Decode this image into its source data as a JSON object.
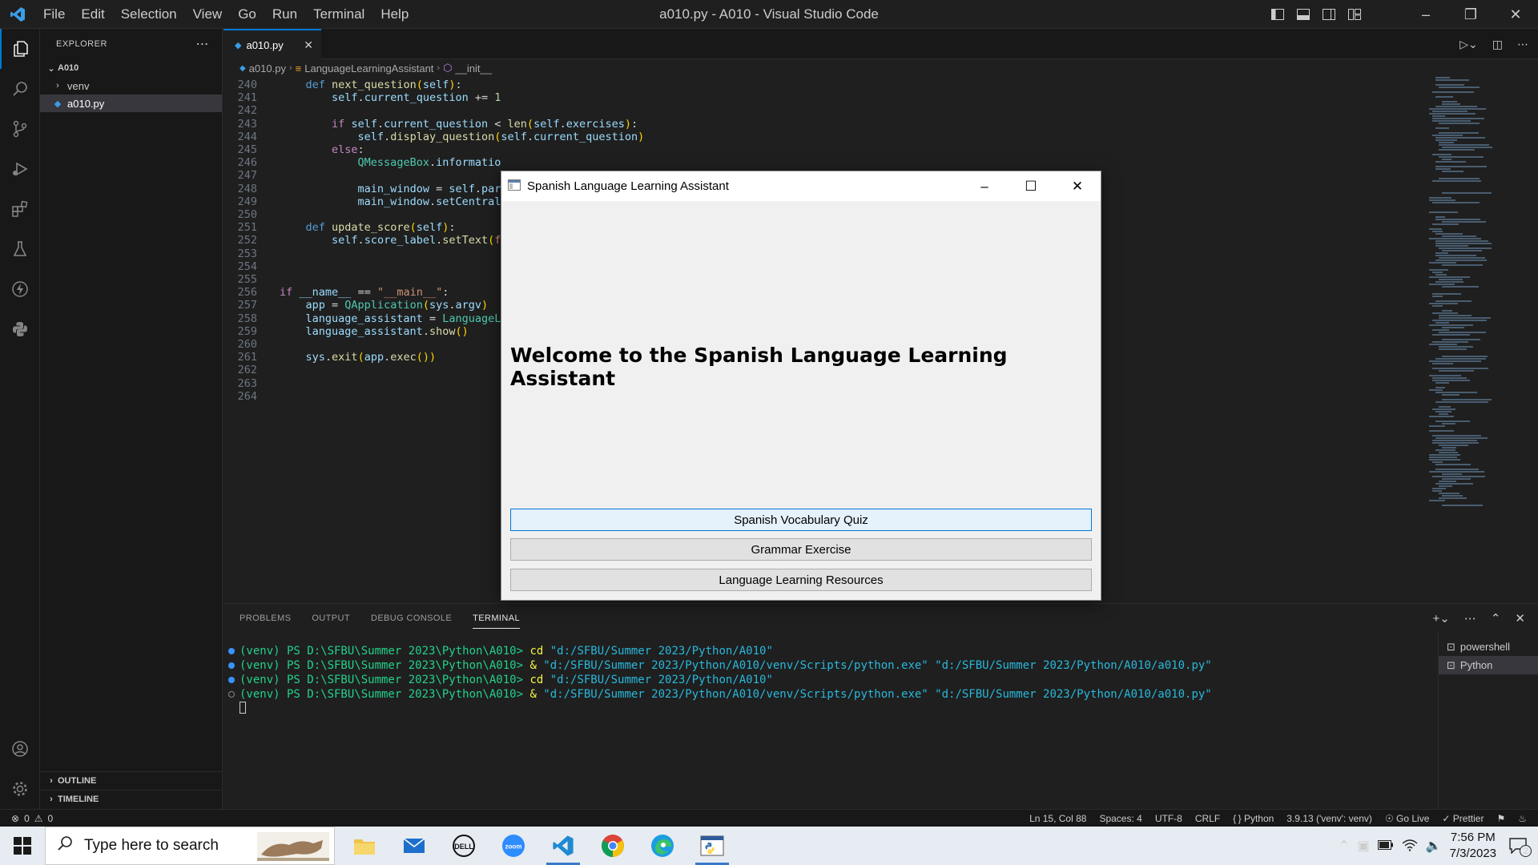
{
  "window_title": "a010.py - A010 - Visual Studio Code",
  "menu": [
    "File",
    "Edit",
    "Selection",
    "View",
    "Go",
    "Run",
    "Terminal",
    "Help"
  ],
  "explorer": {
    "header": "EXPLORER",
    "root": "A010",
    "items": [
      {
        "label": "venv",
        "kind": "folder"
      },
      {
        "label": "a010.py",
        "kind": "python-file",
        "selected": true
      }
    ],
    "outline": "OUTLINE",
    "timeline": "TIMELINE"
  },
  "tab": {
    "label": "a010.py"
  },
  "breadcrumb": [
    "a010.py",
    "LanguageLearningAssistant",
    "__init__"
  ],
  "code_lines": [
    {
      "n": "240",
      "text": "    def next_question(self):"
    },
    {
      "n": "241",
      "text": "        self.current_question += 1"
    },
    {
      "n": "242",
      "text": ""
    },
    {
      "n": "243",
      "text": "        if self.current_question < len(self.exercises):"
    },
    {
      "n": "244",
      "text": "            self.display_question(self.current_question)"
    },
    {
      "n": "245",
      "text": "        else:"
    },
    {
      "n": "246",
      "text": "            QMessageBox.informatio"
    },
    {
      "n": "247",
      "text": ""
    },
    {
      "n": "248",
      "text": "            main_window = self.pare"
    },
    {
      "n": "249",
      "text": "            main_window.setCentral"
    },
    {
      "n": "250",
      "text": ""
    },
    {
      "n": "251",
      "text": "    def update_score(self):"
    },
    {
      "n": "252",
      "text": "        self.score_label.setText(f'"
    },
    {
      "n": "253",
      "text": ""
    },
    {
      "n": "254",
      "text": ""
    },
    {
      "n": "255",
      "text": ""
    },
    {
      "n": "256",
      "text": "if __name__ == \"__main__\":"
    },
    {
      "n": "257",
      "text": "    app = QApplication(sys.argv)"
    },
    {
      "n": "258",
      "text": "    language_assistant = LanguageLe"
    },
    {
      "n": "259",
      "text": "    language_assistant.show()"
    },
    {
      "n": "260",
      "text": ""
    },
    {
      "n": "261",
      "text": "    sys.exit(app.exec())"
    },
    {
      "n": "262",
      "text": ""
    },
    {
      "n": "263",
      "text": ""
    },
    {
      "n": "264",
      "text": ""
    }
  ],
  "panel": {
    "tabs": [
      "PROBLEMS",
      "OUTPUT",
      "DEBUG CONSOLE",
      "TERMINAL"
    ],
    "active_tab": "TERMINAL",
    "terminal_lines": [
      {
        "prompt": "(venv) PS D:\\SFBU\\Summer 2023\\Python\\A010>",
        "cmd": "cd",
        "args": "\"d:/SFBU/Summer 2023/Python/A010\"",
        "status": "filled"
      },
      {
        "prompt": "(venv) PS D:\\SFBU\\Summer 2023\\Python\\A010>",
        "cmd": "&",
        "args": "\"d:/SFBU/Summer 2023/Python/A010/venv/Scripts/python.exe\" \"d:/SFBU/Summer 2023/Python/A010/a010.py\"",
        "status": "filled"
      },
      {
        "prompt": "(venv) PS D:\\SFBU\\Summer 2023\\Python\\A010>",
        "cmd": "cd",
        "args": "\"d:/SFBU/Summer 2023/Python/A010\"",
        "status": "filled"
      },
      {
        "prompt": "(venv) PS D:\\SFBU\\Summer 2023\\Python\\A010>",
        "cmd": "&",
        "args": "\"d:/SFBU/Summer 2023/Python/A010/venv/Scripts/python.exe\" \"d:/SFBU/Summer 2023/Python/A010/a010.py\"",
        "status": "hollow"
      }
    ],
    "terminals": [
      "powershell",
      "Python"
    ]
  },
  "statusbar": {
    "errors": "0",
    "warnings": "0",
    "position": "Ln 15, Col 88",
    "spaces": "Spaces: 4",
    "encoding": "UTF-8",
    "eol": "CRLF",
    "language": "Python",
    "interpreter": "3.9.13 ('venv': venv)",
    "golive": "Go Live",
    "prettier": "Prettier"
  },
  "app_window": {
    "title": "Spanish Language Learning Assistant",
    "welcome": "Welcome to the Spanish Language Learning Assistant",
    "buttons": [
      "Spanish Vocabulary Quiz",
      "Grammar Exercise",
      "Language Learning Resources"
    ]
  },
  "taskbar": {
    "search_placeholder": "Type here to search",
    "time": "7:56 PM",
    "date": "7/3/2023",
    "notifications": "2",
    "apps": [
      "file-explorer",
      "mail",
      "dell",
      "zoom",
      "vscode",
      "chrome",
      "edge",
      "python"
    ]
  },
  "colors": {
    "accent": "#0078d4",
    "editor_bg": "#1f1f1f",
    "sidebar_bg": "#181818",
    "taskbar_bg": "#e6ecf2"
  }
}
